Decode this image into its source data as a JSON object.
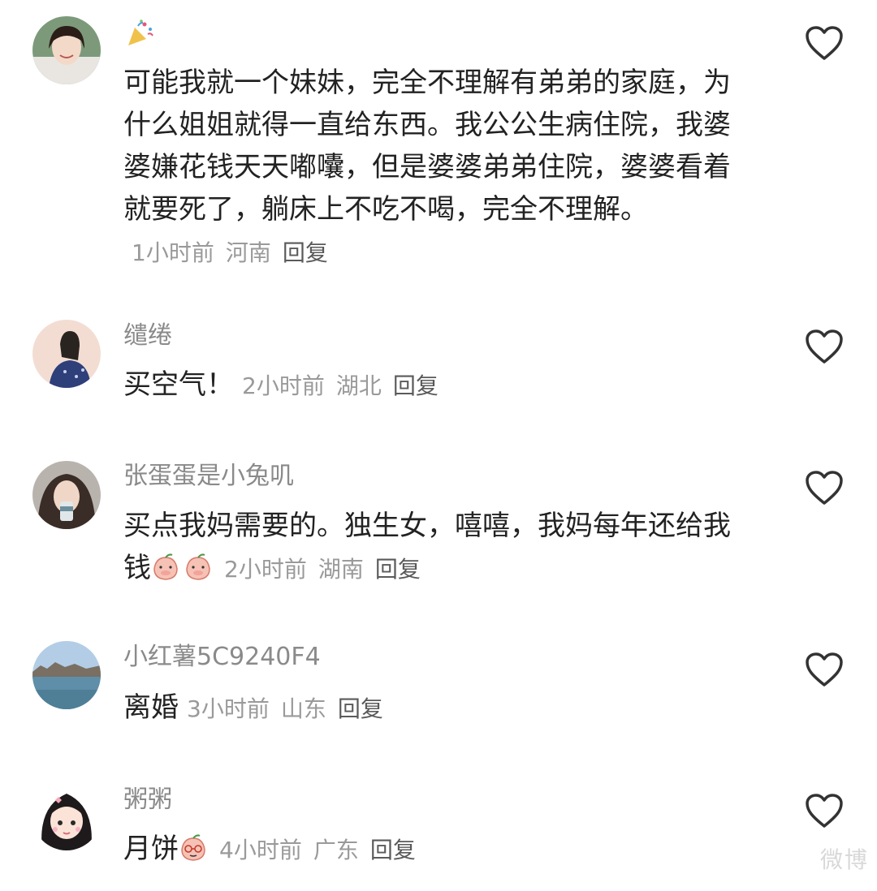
{
  "comments": [
    {
      "username": "",
      "user_badge_icon": "party-popper-icon",
      "text": "可能我就一个妹妹，完全不理解有弟弟的家庭，为什么姐姐就得一直给东西。我公公生病住院，我婆婆嫌花钱天天嘟囔，但是婆婆弟弟住院，婆婆看着就要死了，躺床上不吃不喝，完全不理解。",
      "time": "1小时前",
      "location": "河南",
      "reply": "回复"
    },
    {
      "username": "缱绻",
      "text": "买空气！",
      "time": "2小时前",
      "location": "湖北",
      "reply": "回复"
    },
    {
      "username": "张蛋蛋是小兔叽",
      "text": "买点我妈需要的。独生女，嘻嘻，我妈每年还给我钱",
      "emoji": "peach-shy-emoji",
      "time": "2小时前",
      "location": "湖南",
      "reply": "回复"
    },
    {
      "username": "小红薯5C9240F4",
      "text": "离婚",
      "time": "3小时前",
      "location": "山东",
      "reply": "回复"
    },
    {
      "username": "粥粥",
      "text": "月饼",
      "emoji": "peach-glasses-emoji",
      "time": "4小时前",
      "location": "广东",
      "reply": "回复"
    }
  ],
  "watermark": "微博",
  "like_icon": "heart-outline-icon",
  "colors": {
    "text": "#222222",
    "username": "#8a8a8a",
    "meta": "#9a9a9a",
    "reply": "#5a5a5a",
    "icon": "#333333"
  }
}
